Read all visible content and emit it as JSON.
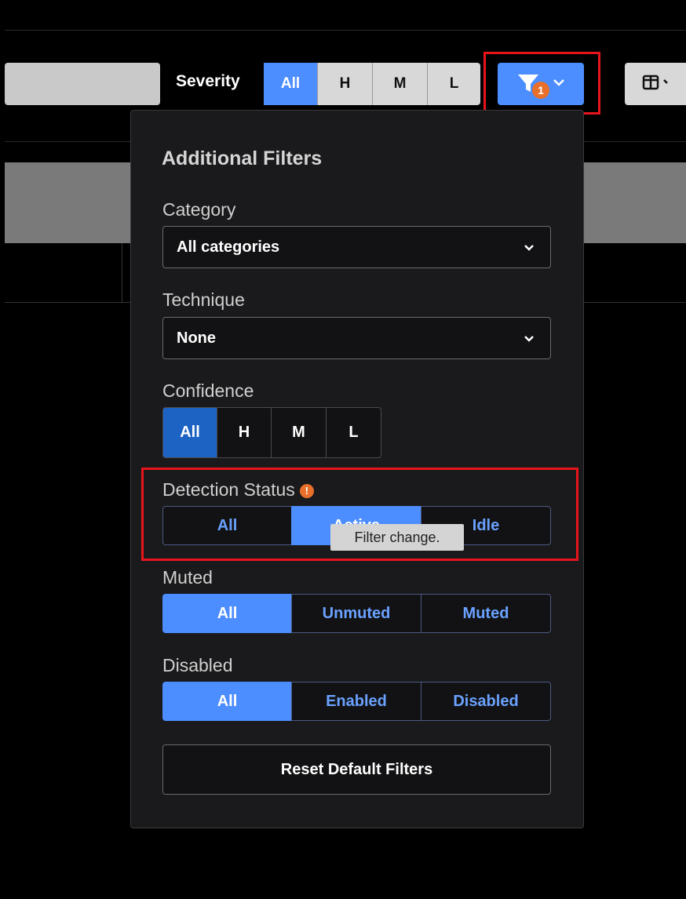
{
  "toolbar": {
    "severity_label": "Severity",
    "severity_options": [
      "All",
      "H",
      "M",
      "L"
    ],
    "severity_selected": "All",
    "filter_badge_count": "1",
    "filter_icon": "funnel-icon",
    "columns_icon": "columns-icon"
  },
  "panel": {
    "title": "Additional Filters",
    "category": {
      "label": "Category",
      "value": "All categories"
    },
    "technique": {
      "label": "Technique",
      "value": "None"
    },
    "confidence": {
      "label": "Confidence",
      "options": [
        "All",
        "H",
        "M",
        "L"
      ],
      "selected": "All"
    },
    "detection_status": {
      "label": "Detection Status",
      "options": [
        "All",
        "Active",
        "Idle"
      ],
      "selected": "Active",
      "tooltip": "Filter change."
    },
    "muted": {
      "label": "Muted",
      "options": [
        "All",
        "Unmuted",
        "Muted"
      ],
      "selected": "All"
    },
    "disabled": {
      "label": "Disabled",
      "options": [
        "All",
        "Enabled",
        "Disabled"
      ],
      "selected": "All"
    },
    "reset_label": "Reset Default Filters"
  },
  "colors": {
    "accent": "#4c8dff",
    "highlight": "#e8141c",
    "badge": "#e8702a"
  }
}
